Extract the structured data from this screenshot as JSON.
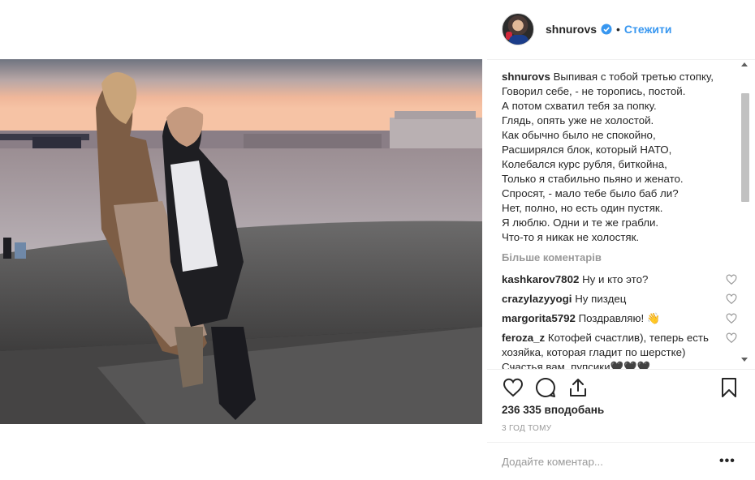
{
  "post": {
    "username": "shnurovs",
    "follow_label": "Стежити",
    "separator": "•",
    "caption_lines": [
      "Выпивая с тобой третью стопку,",
      "Говорил себе, - не торопись, постой.",
      "А потом схватил тебя за попку.",
      "Глядь, опять уже не холостой.",
      "Как обычно было не спокойно,",
      "Расширялся блок, который НАТО,",
      "Колебался курс рубля, биткойна,",
      "Только я стабильно пьяно и женато.",
      "Спросят, - мало тебе было баб ли?",
      "Нет, полно, но есть один пустяк.",
      "Я люблю. Одни и те же грабли.",
      "Что-то я никак не холостяк."
    ],
    "more_comments_label": "Більше коментарів",
    "comments": [
      {
        "user": "kashkarov7802",
        "text": "Ну и кто это?"
      },
      {
        "user": "crazylazyyogi",
        "text": "Ну пиздец"
      },
      {
        "user": "margorita5792",
        "text": "Поздравляю! 👋"
      },
      {
        "user": "feroza_z",
        "text": "Котофей счастлив), теперь есть хозяйка, которая гладит по шерстке) Счастья вам, пупсики🖤🖤🖤"
      }
    ],
    "likes": "236 335 вподобань",
    "time_ago": "3 ГОД ТОМУ",
    "add_comment_placeholder": "Додайте коментар...",
    "more_options": "•••"
  },
  "icons": {
    "verified": "verified-badge-icon",
    "like": "heart-icon",
    "comment": "comment-icon",
    "share": "share-icon",
    "save": "bookmark-icon",
    "comment_like": "heart-outline-icon"
  },
  "colors": {
    "accent": "#3897f0",
    "text": "#262626",
    "muted": "#999999"
  }
}
